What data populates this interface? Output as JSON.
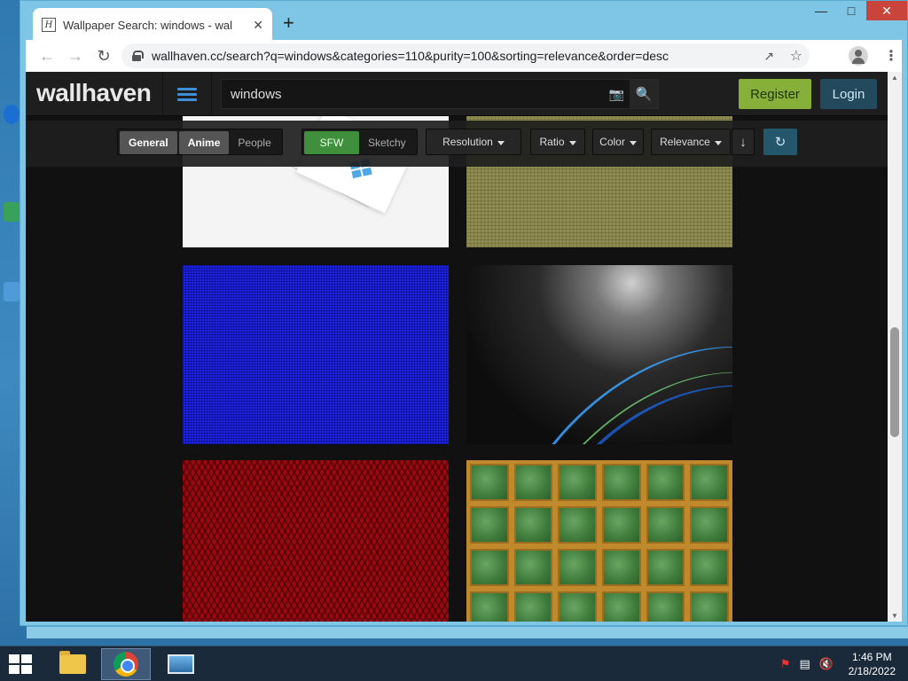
{
  "browser": {
    "tab_title": "Wallpaper Search: windows - wal",
    "favicon_letter": "H",
    "new_tab": "+",
    "url": "wallhaven.cc/search?q=windows&categories=110&purity=100&sorting=relevance&order=desc"
  },
  "site": {
    "logo": "wallhaven",
    "search_value": "windows",
    "register_label": "Register",
    "login_label": "Login"
  },
  "filters": {
    "categories": [
      "General",
      "Anime",
      "People"
    ],
    "purity": [
      "SFW",
      "Sketchy"
    ],
    "selects": [
      "Resolution",
      "Ratio",
      "Color",
      "Relevance"
    ]
  },
  "taskbar": {
    "time": "1:46 PM",
    "date": "2/18/2022"
  }
}
